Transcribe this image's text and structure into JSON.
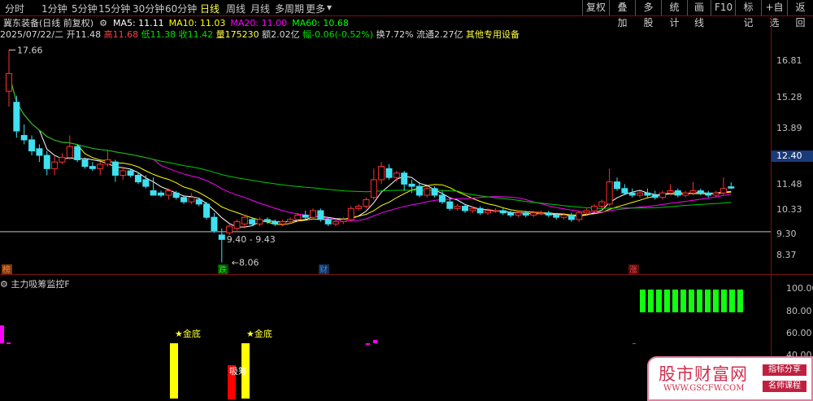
{
  "toolbar": {
    "periods": [
      "分时",
      "1分钟",
      "5分钟",
      "15分钟",
      "30分钟",
      "60分钟",
      "日线",
      "周线",
      "月线",
      "多周期",
      "更多"
    ],
    "active_period": "日线",
    "right_buttons": [
      "复权",
      "叠加",
      "多股",
      "统计",
      "画线",
      "F10",
      "标记",
      "+自选",
      "返回"
    ]
  },
  "stock": {
    "title": "冀东装备(日线 前复权)",
    "ma": [
      {
        "label": "MA5: 11.11",
        "color": "#ffffff"
      },
      {
        "label": "MA10: 11.03",
        "color": "#ffff00"
      },
      {
        "label": "MA20: 11.00",
        "color": "#ff00ff"
      },
      {
        "label": "MA60: 10.68",
        "color": "#00ff00"
      }
    ],
    "date": "2025/07/22/二",
    "open": "开11.48",
    "high": "高11.68",
    "low": "低11.38",
    "close": "收11.42",
    "volume": "量175230",
    "amount": "额2.02亿",
    "change": "幅-0.06(-0.52%)",
    "turnover": "换7.72%",
    "float_mv": "流通2.27亿",
    "sector": "其他专用设备"
  },
  "price_axis": [
    "16.81",
    "15.28",
    "13.89",
    "11.48",
    "10.33",
    "9.30",
    "8.37"
  ],
  "current_price": "12.40",
  "annotations": {
    "high_label": "17.66",
    "low_label": "8.06",
    "range_label": "9.40 - 9.43"
  },
  "markers": [
    {
      "text": "榜",
      "color": "#ff8040"
    },
    {
      "text": "跌",
      "color": "#00ff00"
    },
    {
      "text": "财",
      "color": "#4080ff"
    },
    {
      "text": "涨",
      "color": "#ff4040"
    }
  ],
  "indicator": {
    "title": "主力吸筹监控F",
    "axis": [
      "100.00",
      "80.00",
      "60.00",
      "40.00"
    ],
    "signals": [
      {
        "text": "★金底"
      },
      {
        "text": "★金底"
      },
      {
        "text": "吸筹"
      }
    ]
  },
  "watermark": {
    "name": "股市财富网",
    "url": "WWW.GSCFW.COM",
    "tag1": "指标分享",
    "tag2": "名师课程"
  },
  "chart_data": {
    "type": "candlestick",
    "ylim": [
      7.9,
      17.9
    ],
    "candles": [
      {
        "o": 15.8,
        "h": 17.66,
        "l": 15.1,
        "c": 16.6
      },
      {
        "o": 15.3,
        "h": 15.6,
        "l": 13.7,
        "c": 14.0
      },
      {
        "o": 13.8,
        "h": 14.3,
        "l": 13.4,
        "c": 13.6
      },
      {
        "o": 13.6,
        "h": 13.8,
        "l": 12.9,
        "c": 13.1
      },
      {
        "o": 13.2,
        "h": 13.4,
        "l": 12.6,
        "c": 12.9
      },
      {
        "o": 12.9,
        "h": 13.1,
        "l": 12.0,
        "c": 12.3
      },
      {
        "o": 12.3,
        "h": 12.9,
        "l": 12.0,
        "c": 12.6
      },
      {
        "o": 12.6,
        "h": 13.0,
        "l": 12.5,
        "c": 12.8
      },
      {
        "o": 12.8,
        "h": 13.8,
        "l": 12.7,
        "c": 13.3
      },
      {
        "o": 13.3,
        "h": 13.4,
        "l": 12.6,
        "c": 12.7
      },
      {
        "o": 12.7,
        "h": 12.8,
        "l": 12.3,
        "c": 12.4
      },
      {
        "o": 12.4,
        "h": 12.6,
        "l": 12.2,
        "c": 12.3
      },
      {
        "o": 12.3,
        "h": 12.6,
        "l": 12.0,
        "c": 12.5
      },
      {
        "o": 12.5,
        "h": 13.1,
        "l": 12.4,
        "c": 12.7
      },
      {
        "o": 12.6,
        "h": 12.7,
        "l": 11.7,
        "c": 12.0
      },
      {
        "o": 12.0,
        "h": 12.4,
        "l": 11.8,
        "c": 12.2
      },
      {
        "o": 12.2,
        "h": 12.3,
        "l": 11.9,
        "c": 12.0
      },
      {
        "o": 12.0,
        "h": 12.1,
        "l": 11.6,
        "c": 11.7
      },
      {
        "o": 11.8,
        "h": 12.0,
        "l": 11.4,
        "c": 11.5
      },
      {
        "o": 11.3,
        "h": 11.9,
        "l": 11.1,
        "c": 11.1
      },
      {
        "o": 11.2,
        "h": 11.3,
        "l": 11.0,
        "c": 11.1
      },
      {
        "o": 11.1,
        "h": 11.4,
        "l": 10.9,
        "c": 11.3
      },
      {
        "o": 11.2,
        "h": 11.3,
        "l": 10.9,
        "c": 11.0
      },
      {
        "o": 11.0,
        "h": 11.1,
        "l": 10.7,
        "c": 10.8
      },
      {
        "o": 10.8,
        "h": 11.2,
        "l": 10.7,
        "c": 11.0
      },
      {
        "o": 10.9,
        "h": 11.0,
        "l": 10.6,
        "c": 10.7
      },
      {
        "o": 10.7,
        "h": 10.8,
        "l": 10.0,
        "c": 10.1
      },
      {
        "o": 10.1,
        "h": 10.3,
        "l": 9.4,
        "c": 9.5
      },
      {
        "o": 9.3,
        "h": 9.6,
        "l": 8.06,
        "c": 9.1
      },
      {
        "o": 9.4,
        "h": 9.8,
        "l": 9.3,
        "c": 9.7
      },
      {
        "o": 9.6,
        "h": 10.0,
        "l": 9.5,
        "c": 9.9
      },
      {
        "o": 9.8,
        "h": 10.2,
        "l": 9.6,
        "c": 10.1
      },
      {
        "o": 10.0,
        "h": 10.1,
        "l": 9.7,
        "c": 9.8
      },
      {
        "o": 9.8,
        "h": 10.1,
        "l": 9.7,
        "c": 10.0
      },
      {
        "o": 10.0,
        "h": 10.1,
        "l": 9.8,
        "c": 9.9
      },
      {
        "o": 9.9,
        "h": 10.0,
        "l": 9.7,
        "c": 9.8
      },
      {
        "o": 9.8,
        "h": 10.0,
        "l": 9.7,
        "c": 9.9
      },
      {
        "o": 9.9,
        "h": 10.1,
        "l": 9.8,
        "c": 10.0
      },
      {
        "o": 10.0,
        "h": 10.3,
        "l": 9.9,
        "c": 10.2
      },
      {
        "o": 10.2,
        "h": 10.4,
        "l": 10.0,
        "c": 10.1
      },
      {
        "o": 10.1,
        "h": 10.5,
        "l": 10.0,
        "c": 10.4
      },
      {
        "o": 10.4,
        "h": 10.5,
        "l": 9.9,
        "c": 10.0
      },
      {
        "o": 10.0,
        "h": 10.1,
        "l": 9.7,
        "c": 9.8
      },
      {
        "o": 9.8,
        "h": 10.0,
        "l": 9.7,
        "c": 9.9
      },
      {
        "o": 9.9,
        "h": 10.1,
        "l": 9.8,
        "c": 10.0
      },
      {
        "o": 10.0,
        "h": 10.6,
        "l": 9.9,
        "c": 10.5
      },
      {
        "o": 10.5,
        "h": 10.7,
        "l": 10.4,
        "c": 10.6
      },
      {
        "o": 10.6,
        "h": 11.0,
        "l": 10.5,
        "c": 10.9
      },
      {
        "o": 11.0,
        "h": 12.3,
        "l": 10.9,
        "c": 11.8
      },
      {
        "o": 11.8,
        "h": 12.6,
        "l": 11.6,
        "c": 12.4
      },
      {
        "o": 12.3,
        "h": 12.5,
        "l": 11.8,
        "c": 11.9
      },
      {
        "o": 11.9,
        "h": 12.2,
        "l": 11.7,
        "c": 12.1
      },
      {
        "o": 12.1,
        "h": 12.2,
        "l": 11.3,
        "c": 11.6
      },
      {
        "o": 11.6,
        "h": 11.8,
        "l": 11.2,
        "c": 11.5
      },
      {
        "o": 11.5,
        "h": 11.7,
        "l": 11.0,
        "c": 11.1
      },
      {
        "o": 11.1,
        "h": 11.5,
        "l": 11.0,
        "c": 11.4
      },
      {
        "o": 11.4,
        "h": 11.5,
        "l": 11.0,
        "c": 11.1
      },
      {
        "o": 11.1,
        "h": 11.3,
        "l": 10.7,
        "c": 10.8
      },
      {
        "o": 10.8,
        "h": 11.0,
        "l": 10.4,
        "c": 10.5
      },
      {
        "o": 10.5,
        "h": 10.7,
        "l": 10.4,
        "c": 10.6
      },
      {
        "o": 10.6,
        "h": 10.7,
        "l": 10.3,
        "c": 10.4
      },
      {
        "o": 10.4,
        "h": 10.6,
        "l": 10.3,
        "c": 10.5
      },
      {
        "o": 10.5,
        "h": 10.6,
        "l": 10.2,
        "c": 10.3
      },
      {
        "o": 10.3,
        "h": 10.5,
        "l": 10.2,
        "c": 10.4
      },
      {
        "o": 10.4,
        "h": 10.5,
        "l": 10.3,
        "c": 10.4
      },
      {
        "o": 10.4,
        "h": 10.5,
        "l": 10.2,
        "c": 10.3
      },
      {
        "o": 10.3,
        "h": 10.4,
        "l": 10.1,
        "c": 10.2
      },
      {
        "o": 10.2,
        "h": 10.4,
        "l": 10.1,
        "c": 10.3
      },
      {
        "o": 10.3,
        "h": 10.4,
        "l": 10.1,
        "c": 10.2
      },
      {
        "o": 10.2,
        "h": 10.4,
        "l": 10.1,
        "c": 10.3
      },
      {
        "o": 10.3,
        "h": 10.4,
        "l": 10.2,
        "c": 10.3
      },
      {
        "o": 10.3,
        "h": 10.4,
        "l": 10.1,
        "c": 10.2
      },
      {
        "o": 10.2,
        "h": 10.3,
        "l": 10.0,
        "c": 10.1
      },
      {
        "o": 10.1,
        "h": 10.3,
        "l": 10.0,
        "c": 10.2
      },
      {
        "o": 10.2,
        "h": 10.3,
        "l": 9.9,
        "c": 10.0
      },
      {
        "o": 10.0,
        "h": 10.4,
        "l": 9.9,
        "c": 10.3
      },
      {
        "o": 10.3,
        "h": 10.5,
        "l": 10.2,
        "c": 10.4
      },
      {
        "o": 10.4,
        "h": 10.7,
        "l": 10.3,
        "c": 10.6
      },
      {
        "o": 10.6,
        "h": 10.9,
        "l": 10.5,
        "c": 10.8
      },
      {
        "o": 10.7,
        "h": 12.3,
        "l": 10.6,
        "c": 11.7
      },
      {
        "o": 11.7,
        "h": 11.9,
        "l": 11.3,
        "c": 11.4
      },
      {
        "o": 11.4,
        "h": 11.6,
        "l": 11.1,
        "c": 11.2
      },
      {
        "o": 11.2,
        "h": 11.4,
        "l": 11.0,
        "c": 11.1
      },
      {
        "o": 11.1,
        "h": 11.3,
        "l": 11.0,
        "c": 11.2
      },
      {
        "o": 11.2,
        "h": 11.4,
        "l": 11.0,
        "c": 11.1
      },
      {
        "o": 11.1,
        "h": 11.3,
        "l": 10.9,
        "c": 11.0
      },
      {
        "o": 11.0,
        "h": 11.3,
        "l": 10.9,
        "c": 11.2
      },
      {
        "o": 11.2,
        "h": 11.6,
        "l": 11.1,
        "c": 11.3
      },
      {
        "o": 11.3,
        "h": 11.4,
        "l": 11.0,
        "c": 11.1
      },
      {
        "o": 11.1,
        "h": 11.3,
        "l": 11.0,
        "c": 11.2
      },
      {
        "o": 11.2,
        "h": 11.7,
        "l": 11.1,
        "c": 11.3
      },
      {
        "o": 11.3,
        "h": 11.4,
        "l": 11.1,
        "c": 11.2
      },
      {
        "o": 11.2,
        "h": 11.3,
        "l": 11.0,
        "c": 11.1
      },
      {
        "o": 11.1,
        "h": 11.3,
        "l": 11.0,
        "c": 11.2
      },
      {
        "o": 11.2,
        "h": 11.9,
        "l": 11.1,
        "c": 11.4
      },
      {
        "o": 11.48,
        "h": 11.68,
        "l": 11.38,
        "c": 11.42
      }
    ],
    "indicator_bars": [
      {
        "idx": 0,
        "value": 35,
        "color": "#ff00ff"
      },
      {
        "idx": 24,
        "value": 28,
        "color": "#ffff00"
      },
      {
        "idx": 32,
        "value": 18,
        "color": "#ff0000"
      },
      {
        "idx": 34,
        "value": 28,
        "color": "#ffff00"
      },
      {
        "idx": 52,
        "value": 47,
        "color": "#ff00ff"
      },
      {
        "idx": 53,
        "value": 48,
        "color": "#ff00ff"
      }
    ],
    "indicator_green_bars": 13,
    "indicator_green_value": 97
  }
}
